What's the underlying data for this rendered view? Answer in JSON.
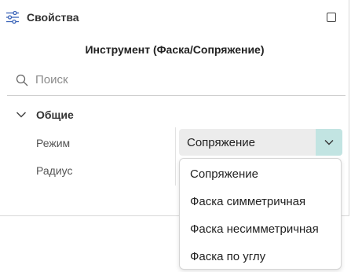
{
  "panel": {
    "title": "Свойства",
    "tool_title": "Инструмент (Фаска/Сопряжение)"
  },
  "search": {
    "placeholder": "Поиск",
    "value": ""
  },
  "group": {
    "label": "Общие",
    "expanded": true
  },
  "properties": {
    "mode_label": "Режим",
    "radius_label": "Радиус"
  },
  "mode_select": {
    "value": "Сопряжение",
    "options": [
      "Сопряжение",
      "Фаска симметричная",
      "Фаска несимметричная",
      "Фаска по углу"
    ]
  },
  "colors": {
    "select_bg": "#ececec",
    "select_button_bg": "#c2e4e2"
  },
  "icons": {
    "header": "sliders-icon",
    "maximize": "maximize-icon",
    "search": "search-icon",
    "group": "chevron-down-icon",
    "select": "chevron-down-icon"
  }
}
